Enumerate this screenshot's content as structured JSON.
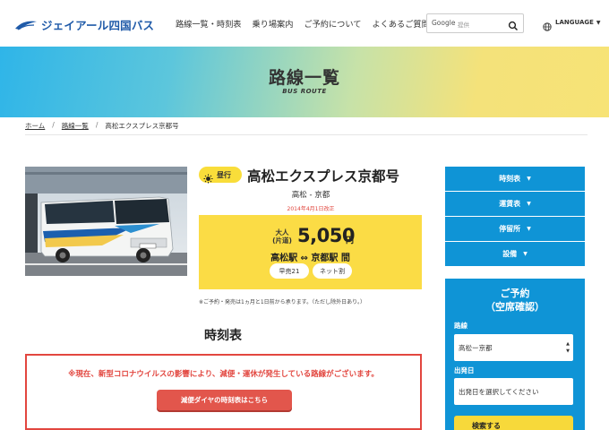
{
  "header": {
    "logo_text": "ジェイアール四国バス",
    "nav": [
      "路線一覧・時刻表",
      "乗り場案内",
      "ご予約について",
      "よくあるご質問"
    ],
    "search": {
      "label": "Google",
      "placeholder": "提供"
    },
    "language_label": "LANGUAGE"
  },
  "hero": {
    "title": "路線一覧",
    "subtitle": "BUS ROUTE"
  },
  "breadcrumb": {
    "home": "ホーム",
    "routes": "路線一覧",
    "current": "高松エクスプレス京都号"
  },
  "route": {
    "badge": "昼行",
    "name": "高松エクスプレス京都号",
    "ends": "高松 - 京都",
    "revision": "2014年4月1日改正",
    "fare_label_1": "大人",
    "fare_label_2": "(片道)",
    "fare_amount": "5,050",
    "fare_unit": "円",
    "fare_route": "高松駅 ⇔ 京都駅 間",
    "tags": [
      "早売21",
      "ネット割"
    ],
    "note": "※ご予約・発売は1ヵ月と1日前から承ります。（ただし除外日あり。）"
  },
  "timetable": {
    "heading": "時刻表",
    "alert": "※現在、新型コロナウイルスの影響により、減便・運休が発生している路線がございます。",
    "alert_button": "減便ダイヤの時刻表はこちら"
  },
  "sidebar": {
    "menu": [
      "時刻表",
      "運賃表",
      "停留所",
      "設備"
    ],
    "reserve_title_1": "ご予約",
    "reserve_title_2": "（空席確認）",
    "route_label": "路線",
    "route_value": "高松ー京都",
    "date_label": "出発日",
    "date_placeholder": "出発日を選択してください",
    "search_button": "検索する"
  },
  "colors": {
    "primary_blue": "#0f94d6",
    "accent_yellow": "#fbdc45",
    "alert_red": "#e2463f"
  }
}
